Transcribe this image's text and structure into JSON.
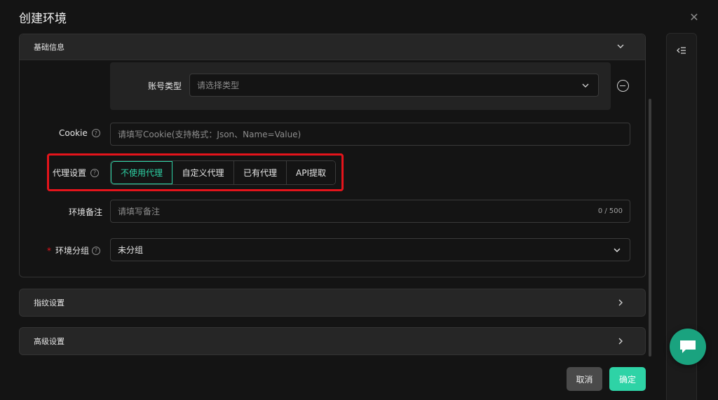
{
  "dialog": {
    "title": "创建环境"
  },
  "sections": {
    "basic": {
      "label": "基础信息"
    },
    "fingerprint": {
      "label": "指纹设置"
    },
    "advanced": {
      "label": "高级设置"
    }
  },
  "account_type": {
    "label": "账号类型",
    "placeholder": "请选择类型"
  },
  "cookie": {
    "label": "Cookie",
    "placeholder": "请填写Cookie(支持格式：Json、Name=Value)"
  },
  "proxy": {
    "label": "代理设置",
    "options": [
      "不使用代理",
      "自定义代理",
      "已有代理",
      "API提取"
    ],
    "selected": "不使用代理"
  },
  "note": {
    "label": "环境备注",
    "placeholder": "请填写备注",
    "counter": "0 / 500"
  },
  "group": {
    "required_mark": "*",
    "label": "环境分组",
    "value": "未分组"
  },
  "footer": {
    "cancel_label": "取消",
    "confirm_label": "确定"
  },
  "colors": {
    "accent": "#2ed3a6",
    "highlight_box": "#e4141b",
    "chat_button": "#1aa37f"
  }
}
